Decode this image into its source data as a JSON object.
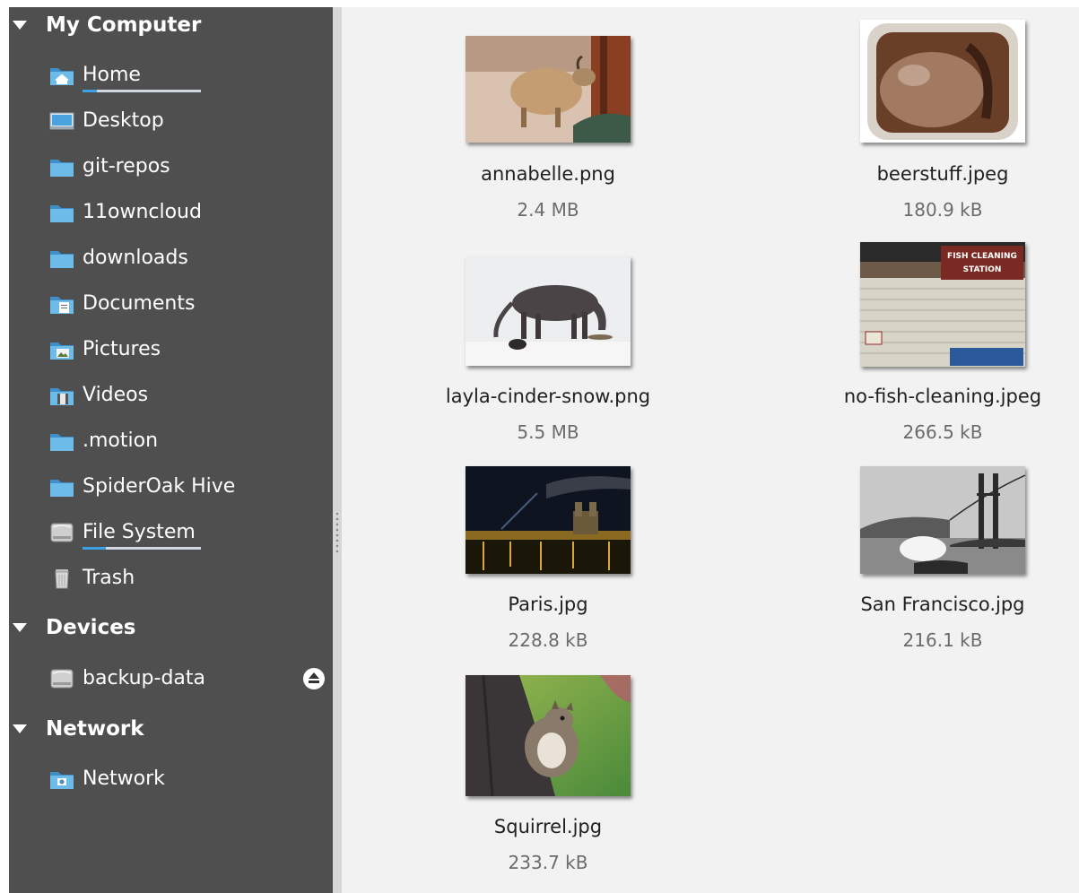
{
  "sidebar": {
    "sections": [
      {
        "title": "My Computer",
        "items": [
          {
            "label": "Home",
            "icon": "home-folder-icon"
          },
          {
            "label": "Desktop",
            "icon": "desktop-icon"
          },
          {
            "label": "git-repos",
            "icon": "folder-icon"
          },
          {
            "label": "11owncloud",
            "icon": "folder-icon"
          },
          {
            "label": "downloads",
            "icon": "folder-icon"
          },
          {
            "label": "Documents",
            "icon": "documents-folder-icon"
          },
          {
            "label": "Pictures",
            "icon": "pictures-folder-icon"
          },
          {
            "label": "Videos",
            "icon": "videos-folder-icon"
          },
          {
            "label": ".motion",
            "icon": "folder-icon"
          },
          {
            "label": "SpiderOak Hive",
            "icon": "folder-icon"
          },
          {
            "label": "File System",
            "icon": "drive-icon"
          },
          {
            "label": "Trash",
            "icon": "trash-icon"
          }
        ]
      },
      {
        "title": "Devices",
        "items": [
          {
            "label": "backup-data",
            "icon": "drive-icon"
          }
        ]
      },
      {
        "title": "Network",
        "items": [
          {
            "label": "Network",
            "icon": "network-icon"
          }
        ]
      }
    ],
    "usage": {
      "home_fraction": 0.12,
      "filesystem_fraction": 0.2
    }
  },
  "files": [
    {
      "name": "annabelle.png",
      "size": "2.4 MB",
      "thumbnail": "goat-photo"
    },
    {
      "name": "beerstuff.jpeg",
      "size": "180.9 kB",
      "thumbnail": "chocolate-jar-photo"
    },
    {
      "name": "layla-cinder-snow.png",
      "size": "5.5 MB",
      "thumbnail": "horse-in-snow-photo"
    },
    {
      "name": "no-fish-cleaning.jpeg",
      "size": "266.5 kB",
      "thumbnail": "fish-cleaning-station-photo",
      "sign_text": [
        "FISH CLEANING",
        "STATION"
      ]
    },
    {
      "name": "Paris.jpg",
      "size": "228.8 kB",
      "thumbnail": "paris-night-photo"
    },
    {
      "name": "San Francisco.jpg",
      "size": "216.1 kB",
      "thumbnail": "golden-gate-bridge-photo"
    },
    {
      "name": "Squirrel.jpg",
      "size": "233.7 kB",
      "thumbnail": "squirrel-photo"
    }
  ],
  "colors": {
    "sidebar_bg": "#4f4f4f",
    "main_bg": "#f2f2f2",
    "usage_fill": "#3da1e6",
    "folder_blue": "#6cbbe8"
  }
}
